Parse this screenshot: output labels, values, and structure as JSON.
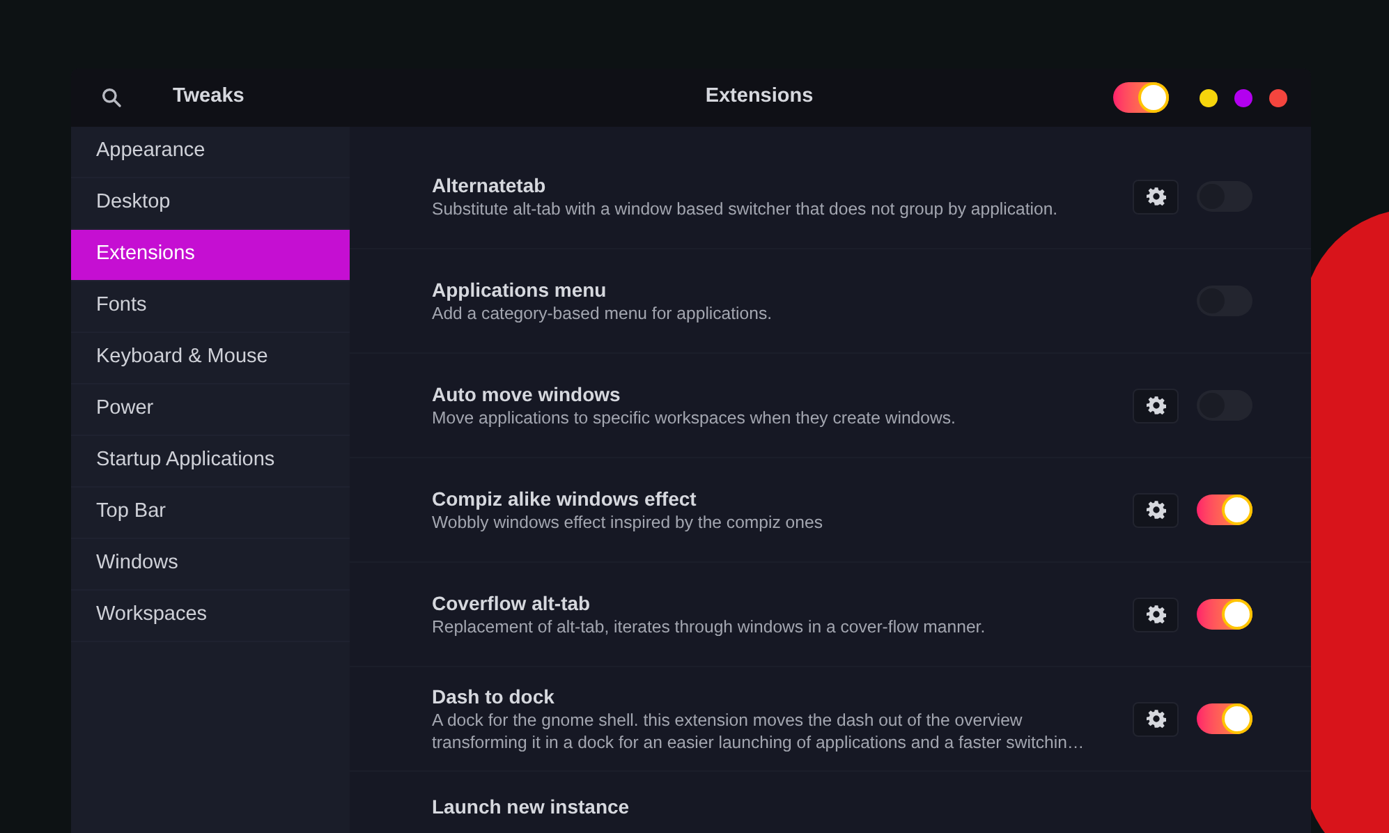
{
  "header": {
    "app_title": "Tweaks",
    "page_title": "Extensions",
    "theme_toggle": {
      "on": true
    }
  },
  "sidebar": {
    "items": [
      {
        "label": "Appearance",
        "selected": false
      },
      {
        "label": "Desktop",
        "selected": false
      },
      {
        "label": "Extensions",
        "selected": true
      },
      {
        "label": "Fonts",
        "selected": false
      },
      {
        "label": "Keyboard & Mouse",
        "selected": false
      },
      {
        "label": "Power",
        "selected": false
      },
      {
        "label": "Startup Applications",
        "selected": false
      },
      {
        "label": "Top Bar",
        "selected": false
      },
      {
        "label": "Windows",
        "selected": false
      },
      {
        "label": "Workspaces",
        "selected": false
      }
    ]
  },
  "extensions": [
    {
      "title": "Alternatetab",
      "description": "Substitute alt-tab with a window based switcher that does not group by application.",
      "settings": true,
      "enabled": false
    },
    {
      "title": "Applications menu",
      "description": "Add a category-based menu for applications.",
      "settings": false,
      "enabled": false
    },
    {
      "title": "Auto move windows",
      "description": "Move applications to specific workspaces when they create windows.",
      "settings": true,
      "enabled": false
    },
    {
      "title": "Compiz alike windows effect",
      "description": "Wobbly windows effect inspired by the compiz ones",
      "settings": true,
      "enabled": true
    },
    {
      "title": "Coverflow alt-tab",
      "description": "Replacement of alt-tab, iterates through windows in a cover-flow manner.",
      "settings": true,
      "enabled": true
    },
    {
      "title": "Dash to dock",
      "description": "A dock for the gnome shell. this extension moves the dash out of the overview transforming it in a dock for an easier launching of applications and a faster switchin…",
      "settings": true,
      "enabled": true
    },
    {
      "title": "Launch new instance"
    }
  ]
}
